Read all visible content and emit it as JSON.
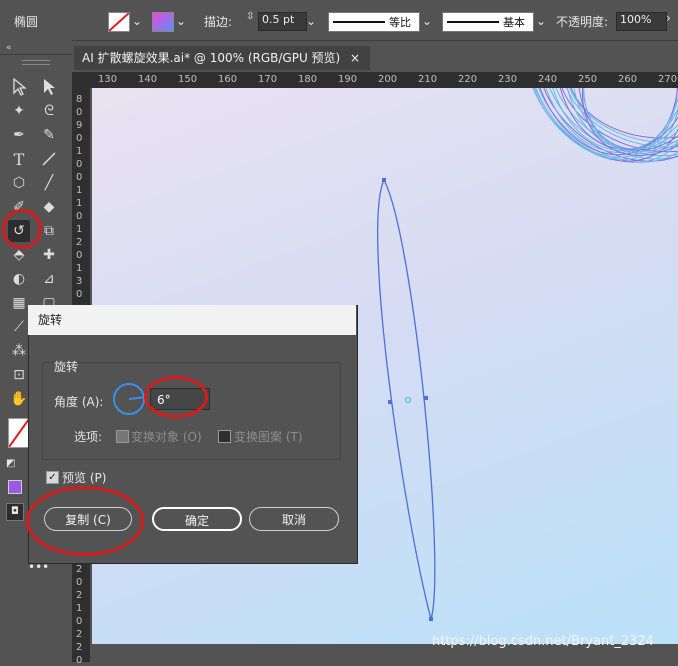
{
  "control_bar": {
    "shape_name": "椭圆",
    "stroke_label": "描边:",
    "stroke_value": "0.5 pt",
    "profile_label": "等比",
    "brush_label": "基本",
    "opacity_label": "不透明度:",
    "opacity_value": "100%"
  },
  "document_tab": {
    "title": "AI 扩散螺旋效果.ai* @ 100% (RGB/GPU 预览)",
    "close": "×"
  },
  "ruler": {
    "h_ticks": [
      "130",
      "140",
      "150",
      "160",
      "170",
      "180",
      "190",
      "200",
      "210",
      "220",
      "230",
      "240",
      "250",
      "260",
      "270"
    ],
    "v_digits_top": [
      "8",
      "0",
      "9",
      "0",
      "1",
      "0",
      "0",
      "1",
      "1",
      "0",
      "1",
      "2",
      "0",
      "1",
      "3",
      "0"
    ],
    "v_digits_bottom": [
      "2",
      "0",
      "2",
      "1",
      "0",
      "2",
      "2",
      "0"
    ]
  },
  "dialog": {
    "title": "旋转",
    "group_label": "旋转",
    "angle_label": "角度 (A):",
    "angle_value": "6°",
    "options_label": "选项:",
    "transform_objects": "变换对象 (O)",
    "transform_patterns": "变换图案 (T)",
    "preview_label": "预览 (P)",
    "copy_button": "复制 (C)",
    "ok_button": "确定",
    "cancel_button": "取消"
  },
  "watermark": "https://blog.csdn.net/Bryant_2324",
  "colors": {
    "accent_red": "#d71b1b",
    "ellipse_stroke": "#4d6fd9",
    "fill_swatch": "#9b59e6"
  }
}
